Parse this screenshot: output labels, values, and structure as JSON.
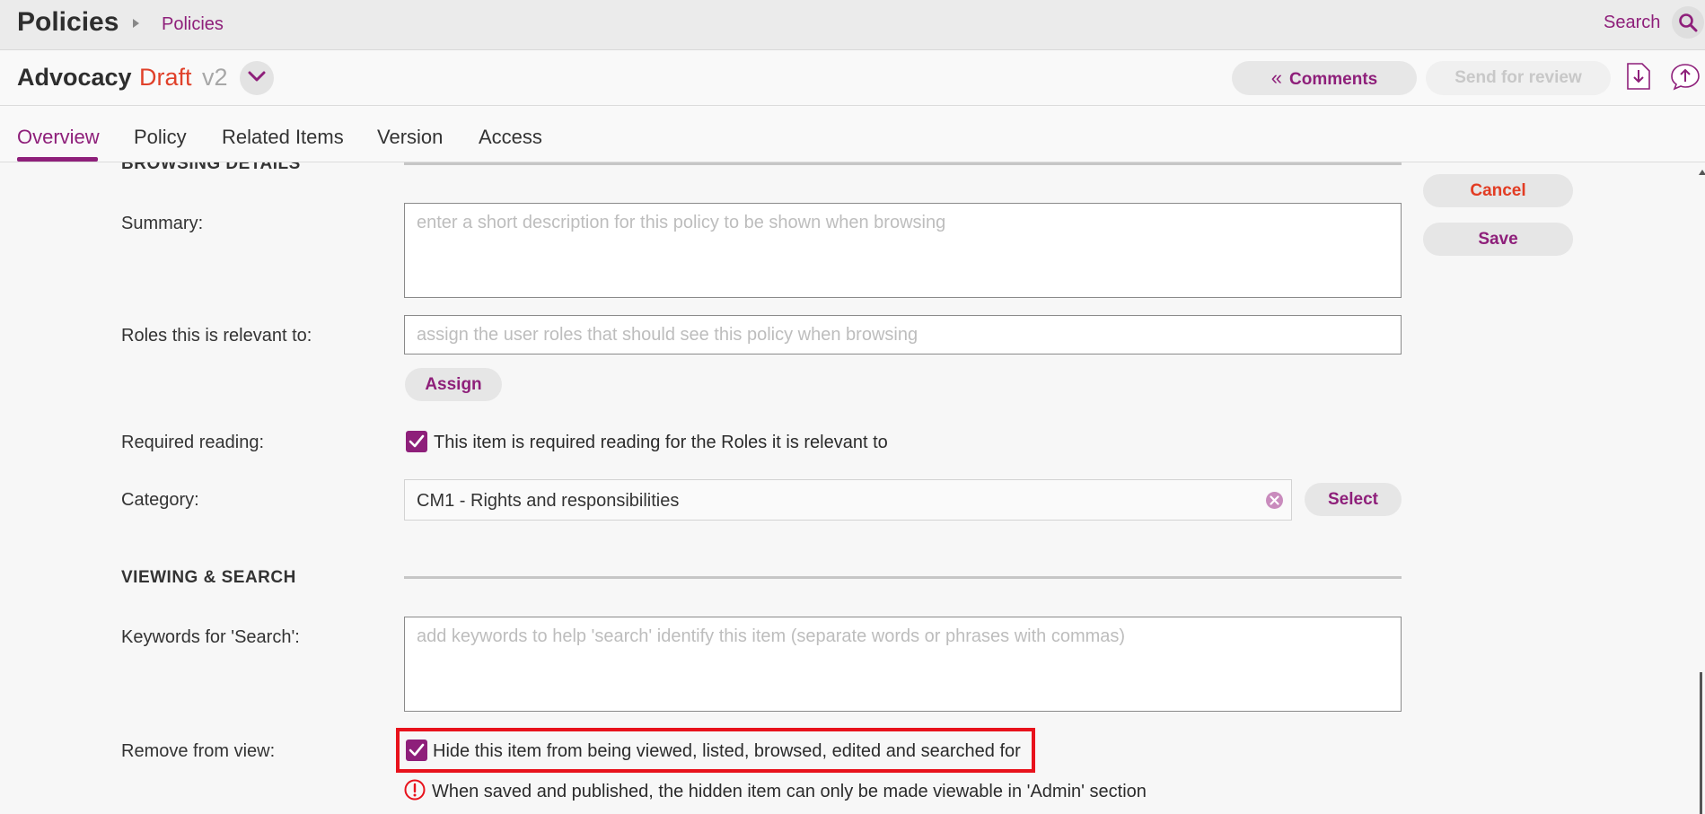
{
  "header": {
    "app_title": "Policies",
    "breadcrumb": "Policies",
    "search_label": "Search"
  },
  "document": {
    "title": "Advocacy",
    "status": "Draft",
    "version": "v2",
    "comments_label": "Comments",
    "send_review_label": "Send for review"
  },
  "tabs": [
    {
      "label": "Overview",
      "active": true
    },
    {
      "label": "Policy"
    },
    {
      "label": "Related Items"
    },
    {
      "label": "Version"
    },
    {
      "label": "Access"
    }
  ],
  "actions": {
    "cancel_label": "Cancel",
    "save_label": "Save"
  },
  "browsing": {
    "section_title": "BROWSING DETAILS",
    "summary_label": "Summary:",
    "summary_placeholder": "enter a short description for this policy to be shown when browsing",
    "roles_label": "Roles this is relevant to:",
    "roles_placeholder": "assign the user roles that should see this policy when browsing",
    "assign_label": "Assign",
    "required_label": "Required reading:",
    "required_text": "This item is required reading for the Roles it is relevant to",
    "required_checked": true,
    "category_label": "Category:",
    "category_value": "CM1 - Rights and responsibilities",
    "select_label": "Select"
  },
  "viewing": {
    "section_title": "VIEWING & SEARCH",
    "keywords_label": "Keywords for 'Search':",
    "keywords_placeholder": "add keywords to help 'search' identify this item (separate words or phrases with commas)",
    "remove_label": "Remove from view:",
    "hide_text": "Hide this item from being viewed, listed, browsed, edited and searched for",
    "hide_checked": true,
    "warning_text": "When saved and published, the hidden item can only be made viewable in 'Admin' section"
  },
  "colors": {
    "accent": "#8e1f7a",
    "draft": "#e0412a",
    "cancel": "#e23c23",
    "highlight": "#e8121c"
  },
  "icons": {
    "search": "search-icon",
    "menu": "chevron-down-icon",
    "download": "download-icon",
    "upload": "upload-icon",
    "clear": "clear-icon",
    "warning": "warning-icon",
    "check": "check-icon"
  }
}
